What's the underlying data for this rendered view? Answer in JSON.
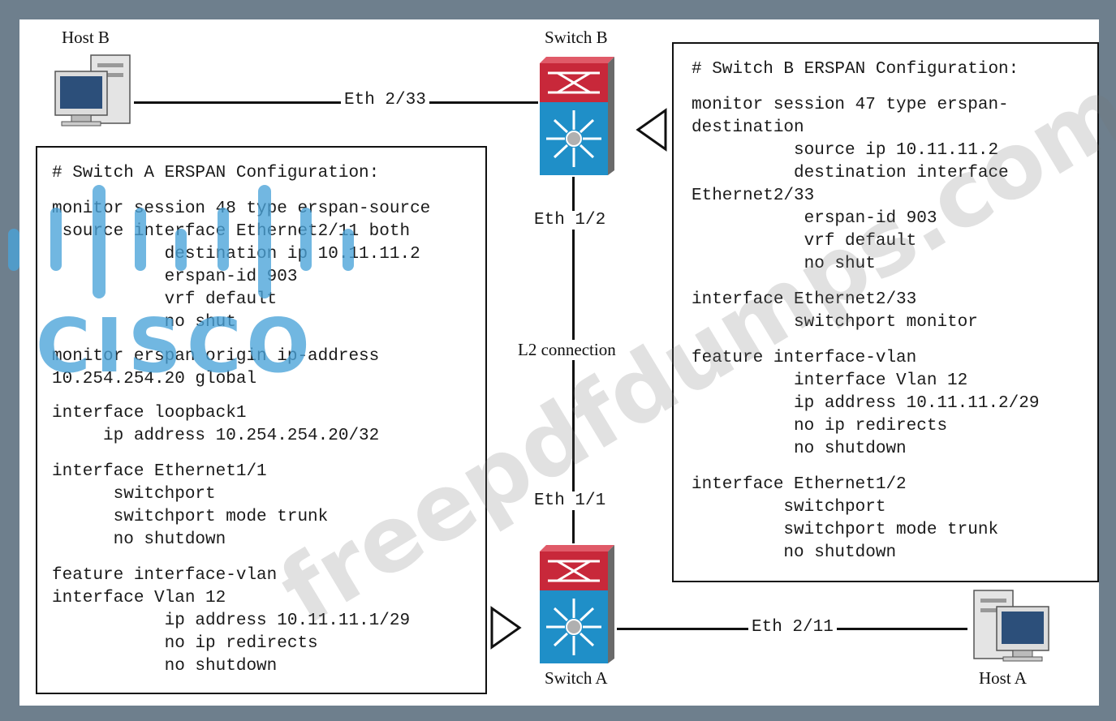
{
  "hosts": {
    "host_b": "Host B",
    "host_a": "Host A"
  },
  "switches": {
    "switch_b": "Switch B",
    "switch_a": "Switch A"
  },
  "links": {
    "hostb_switchb": "Eth 2/33",
    "switchb_port": "Eth 1/2",
    "l2": "L2 connection",
    "switcha_port": "Eth 1/1",
    "switcha_hosta": "Eth 2/11"
  },
  "switch_a_config": {
    "title": "# Switch A ERSPAN Configuration:",
    "lines": [
      "monitor session 48 type erspan-source",
      " source interface Ethernet2/11 both",
      "           destination ip 10.11.11.2",
      "           erspan-id 903",
      "           vrf default",
      "           no shut",
      "monitor erspan origin ip-address",
      "10.254.254.20 global",
      "interface loopback1",
      "     ip address 10.254.254.20/32",
      "interface Ethernet1/1",
      "      switchport",
      "      switchport mode trunk",
      "      no shutdown",
      "feature interface-vlan",
      "interface Vlan 12",
      "           ip address 10.11.11.1/29",
      "           no ip redirects",
      "           no shutdown"
    ]
  },
  "switch_b_config": {
    "title": "# Switch B ERSPAN Configuration:",
    "lines": [
      "monitor session 47 type erspan-",
      "destination",
      "          source ip 10.11.11.2",
      "          destination interface",
      "Ethernet2/33",
      "           erspan-id 903",
      "           vrf default",
      "           no shut",
      "interface Ethernet2/33",
      "          switchport monitor",
      "feature interface-vlan",
      "          interface Vlan 12",
      "          ip address 10.11.11.2/29",
      "          no ip redirects",
      "          no shutdown",
      "interface Ethernet1/2",
      "         switchport",
      "         switchport mode trunk",
      "         no shutdown"
    ]
  },
  "watermarks": {
    "logo_text": "CISCO",
    "site": "freepdfdumps.com"
  },
  "colors": {
    "frame": "#6e7f8d",
    "switch_top": "#c8283a",
    "switch_bottom": "#1f8fc8",
    "cisco_logo": "#4aa3d9"
  }
}
